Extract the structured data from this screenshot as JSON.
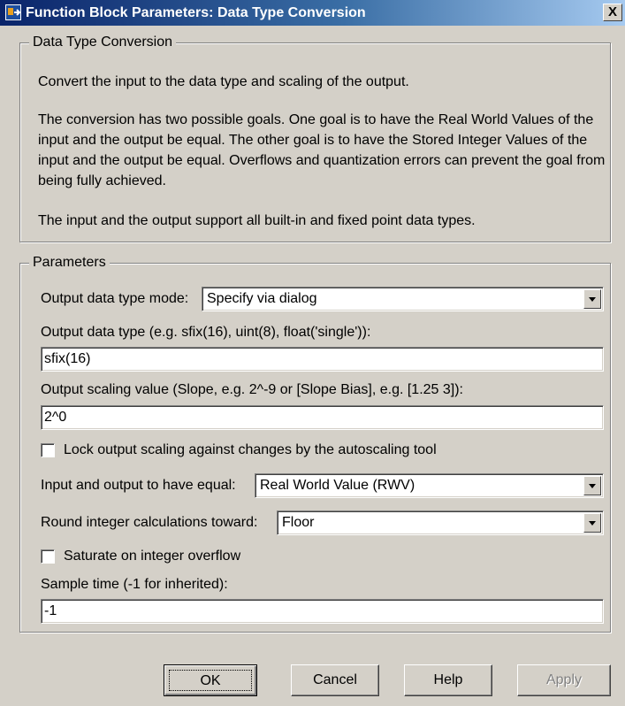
{
  "window": {
    "title": "Function Block Parameters: Data Type Conversion",
    "close_label": "X"
  },
  "description": {
    "legend": "Data Type Conversion",
    "paragraphs": [
      "Convert the input to the data type and scaling of the output.",
      "The conversion has two possible goals. One goal is to have the Real World Values of the input and the output be equal.  The other goal is to have the Stored Integer Values of the input and the output be equal.  Overflows and quantization errors can prevent the goal from being fully achieved.",
      "The input and the output support all built-in and fixed point data types."
    ]
  },
  "parameters": {
    "legend": "Parameters",
    "output_mode": {
      "label": "Output data type mode:",
      "value": "Specify via dialog"
    },
    "output_type": {
      "label": "Output data type (e.g. sfix(16), uint(8), float('single')):",
      "value": "sfix(16)"
    },
    "output_scaling": {
      "label": "Output scaling value (Slope, e.g. 2^-9 or [Slope Bias], e.g. [1.25 3]):",
      "value": "2^0"
    },
    "lock_scaling": {
      "label": "Lock output scaling against changes by the autoscaling tool",
      "checked": false
    },
    "equal_mode": {
      "label": "Input and output to have equal:",
      "value": "Real World Value (RWV)"
    },
    "rounding": {
      "label": "Round integer calculations toward:",
      "value": "Floor"
    },
    "saturate": {
      "label": "Saturate on integer overflow",
      "checked": false
    },
    "sample_time": {
      "label": "Sample time (-1 for inherited):",
      "value": "-1"
    }
  },
  "buttons": {
    "ok": "OK",
    "cancel": "Cancel",
    "help": "Help",
    "apply": "Apply"
  },
  "colors": {
    "titlebar_start": "#0a246a",
    "titlebar_end": "#a6caf0",
    "dialog_face": "#d4d0c8"
  },
  "icons": {
    "app": "simulink-block-icon",
    "dropdown": "chevron-down-icon"
  }
}
